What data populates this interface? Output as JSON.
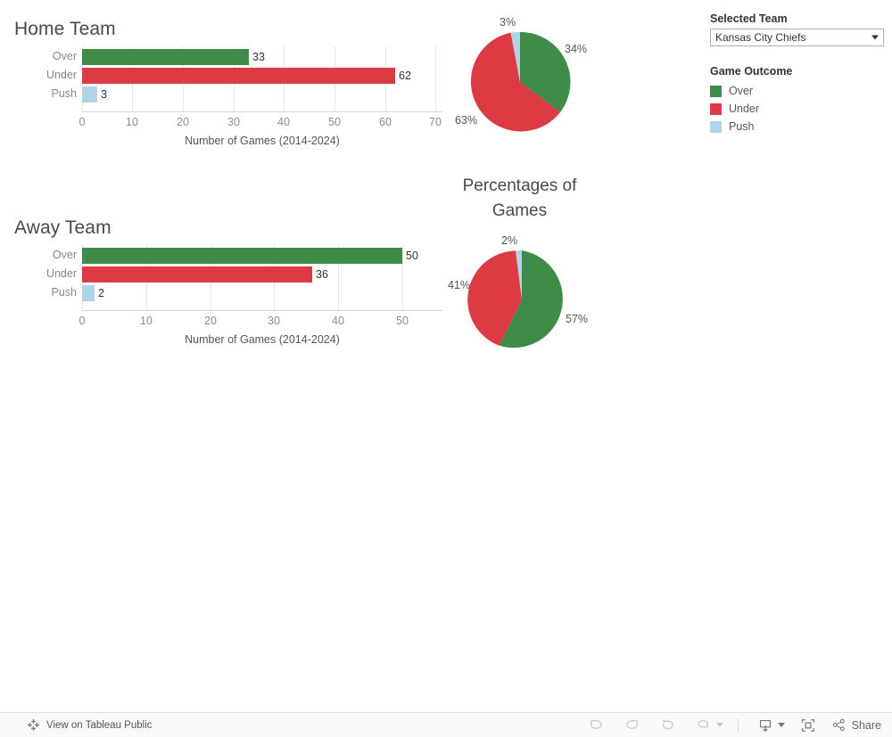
{
  "dashboard": {
    "home_title": "Home Team",
    "away_title": "Away Team",
    "pie_title_line1": "Percentages of",
    "pie_title_line2": "Games"
  },
  "colors": {
    "over": "#3E8C47",
    "under": "#DC3B44",
    "push": "#AFD4E9",
    "grid": "#e6e6e6",
    "axis": "#d6d6d6",
    "text": "#555555",
    "label": "#888888"
  },
  "panel": {
    "selected_team_label": "Selected Team",
    "selected_team_value": "Kansas City Chiefs",
    "legend_title": "Game Outcome",
    "legend_items": [
      {
        "label": "Over",
        "color": "#3E8C47"
      },
      {
        "label": "Under",
        "color": "#DC3B44"
      },
      {
        "label": "Push",
        "color": "#AFD4E9"
      }
    ]
  },
  "toolbar": {
    "view_on_tableau": "View on Tableau Public",
    "share_label": "Share",
    "undo_label": "Undo",
    "redo_label": "Redo",
    "revert_label": "Revert",
    "refresh_label": "Refresh",
    "download_label": "Download",
    "fullscreen_label": "Full Screen"
  },
  "chart_data": [
    {
      "type": "bar",
      "title": "Home Team",
      "orientation": "horizontal",
      "categories": [
        "Over",
        "Under",
        "Push"
      ],
      "values": [
        33,
        62,
        3
      ],
      "value_labels": [
        "33",
        "62",
        "3"
      ],
      "colors": [
        "#3E8C47",
        "#DC3B44",
        "#AFD4E9"
      ],
      "xlabel": "Number of Games (2014-2024)",
      "ylabel": "",
      "xlim": [
        0,
        70
      ],
      "xticks": [
        0,
        10,
        20,
        30,
        40,
        50,
        60,
        70
      ],
      "xticklabels": [
        "0",
        "10",
        "20",
        "30",
        "40",
        "50",
        "60",
        "70"
      ],
      "grid": true,
      "legend": "right panel"
    },
    {
      "type": "pie",
      "title": "",
      "labels": [
        "Over",
        "Under",
        "Push"
      ],
      "values": [
        34,
        63,
        3
      ],
      "value_labels": [
        "34%",
        "63%",
        "3%"
      ],
      "colors": [
        "#3E8C47",
        "#DC3B44",
        "#AFD4E9"
      ],
      "note": "Home Team percentages of games"
    },
    {
      "type": "bar",
      "title": "Away Team",
      "orientation": "horizontal",
      "categories": [
        "Over",
        "Under",
        "Push"
      ],
      "values": [
        50,
        36,
        2
      ],
      "value_labels": [
        "50",
        "36",
        "2"
      ],
      "colors": [
        "#3E8C47",
        "#DC3B44",
        "#AFD4E9"
      ],
      "xlabel": "Number of Games (2014-2024)",
      "ylabel": "",
      "xlim": [
        0,
        55
      ],
      "xticks": [
        0,
        10,
        20,
        30,
        40,
        50
      ],
      "xticklabels": [
        "0",
        "10",
        "20",
        "30",
        "40",
        "50"
      ],
      "grid": true,
      "legend": "right panel"
    },
    {
      "type": "pie",
      "title": "Percentages of Games",
      "labels": [
        "Over",
        "Under",
        "Push"
      ],
      "values": [
        57,
        41,
        2
      ],
      "value_labels": [
        "57%",
        "41%",
        "2%"
      ],
      "colors": [
        "#3E8C47",
        "#DC3B44",
        "#AFD4E9"
      ],
      "note": "Away Team percentages of games"
    }
  ]
}
